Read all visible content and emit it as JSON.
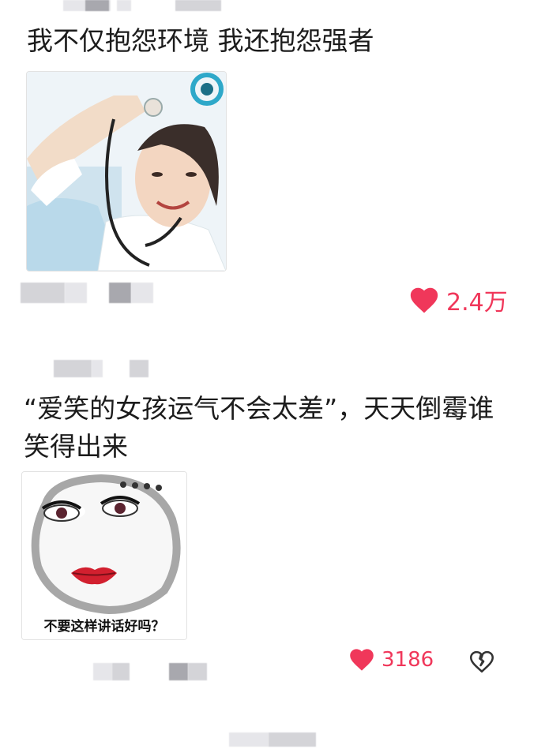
{
  "post1": {
    "text": "我不仅抱怨环境 我还抱怨强者",
    "likes": "2.4万",
    "image_icon": "doctor-stethoscope-photo",
    "like_icon": "heart-icon"
  },
  "post2": {
    "text": "“爱笑的女孩运气不会太差”，天天倒霉谁笑得出来",
    "image_caption": "不要这样讲话好吗？",
    "likes": "3186",
    "like_icon": "heart-icon",
    "dislike_icon": "broken-heart-icon"
  },
  "colors": {
    "accent": "#f0375a",
    "text": "#1c1c1c",
    "redacted": "#d4d4d8"
  }
}
